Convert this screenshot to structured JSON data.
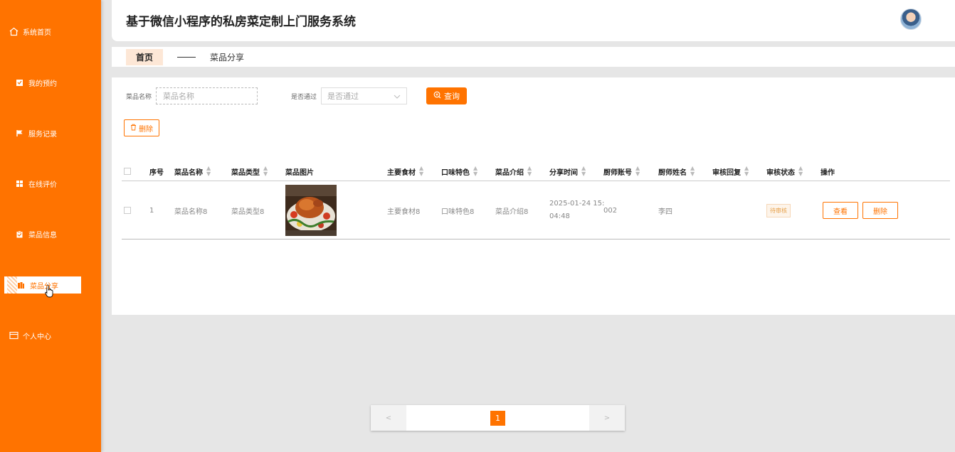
{
  "colors": {
    "primary": "#ff7300",
    "background": "#e6e6e6"
  },
  "sidebar": {
    "items": [
      {
        "label": "系统首页",
        "icon": "home-icon"
      },
      {
        "label": "我的预约",
        "icon": "appointment-icon"
      },
      {
        "label": "服务记录",
        "icon": "flag-icon"
      },
      {
        "label": "在线评价",
        "icon": "grid-icon"
      },
      {
        "label": "菜品信息",
        "icon": "clipboard-icon"
      },
      {
        "label": "菜品分享",
        "icon": "share-icon",
        "active": true
      },
      {
        "label": "个人中心",
        "icon": "card-icon"
      }
    ]
  },
  "header": {
    "title": "基于微信小程序的私房菜定制上门服务系统",
    "avatar_icon": "user-avatar"
  },
  "breadcrumb": {
    "home": "首页",
    "current": "菜品分享"
  },
  "search": {
    "name_label": "菜品名称",
    "name_placeholder": "菜品名称",
    "pass_label": "是否通过",
    "pass_placeholder": "是否通过",
    "query_label": "查询"
  },
  "toolbar": {
    "delete_label": "删除"
  },
  "table": {
    "headers": [
      "序号",
      "菜品名称",
      "菜品类型",
      "菜品图片",
      "主要食材",
      "口味特色",
      "菜品介绍",
      "分享时间",
      "厨师账号",
      "厨师姓名",
      "审核回复",
      "审核状态",
      "操作"
    ],
    "rows": [
      {
        "index": "1",
        "name": "菜品名称8",
        "type": "菜品类型8",
        "ingredients": "主要食材8",
        "flavor": "口味特色8",
        "intro": "菜品介绍8",
        "time_line1": "2025-01-24 15:",
        "time_line2": "04:48",
        "chef_account": "002",
        "chef_name": "李四",
        "reply": "",
        "status": "待审核",
        "view_label": "查看",
        "delete_label": "删除"
      }
    ]
  },
  "pagination": {
    "prev": "<",
    "current": "1",
    "next": ">"
  }
}
